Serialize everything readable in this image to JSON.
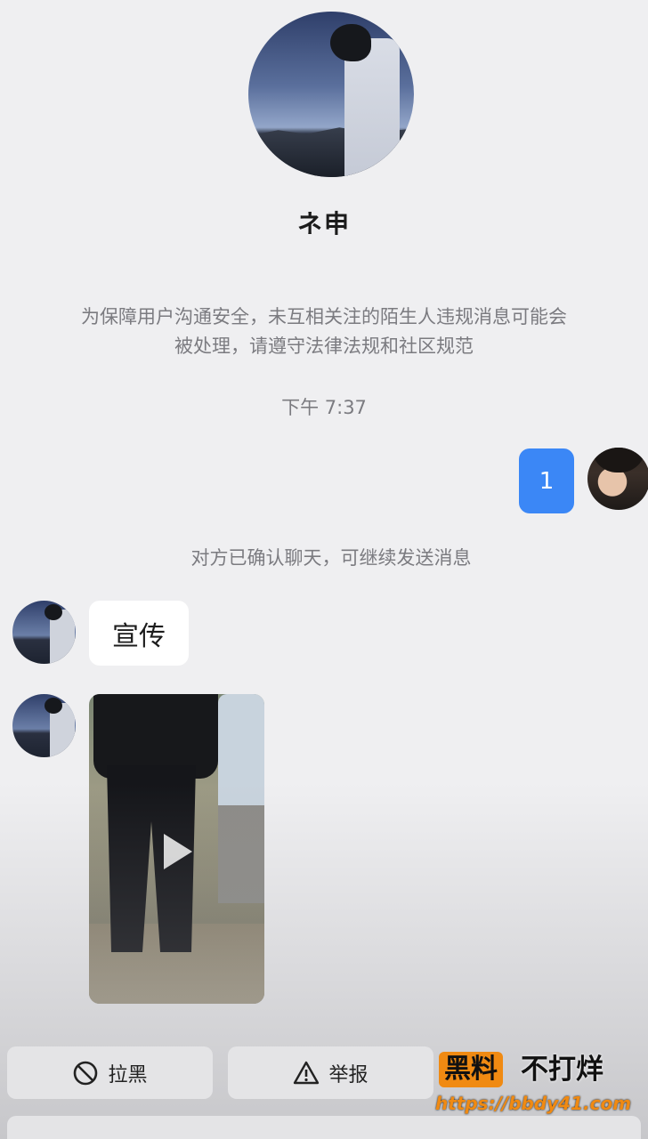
{
  "profile": {
    "name": "ネ申"
  },
  "notice": "为保障用户沟通安全，未互相关注的陌生人违规消息可能会被处理，请遵守法律法规和社区规范",
  "timestamp": "下午 7:37",
  "messages": {
    "outgoing": {
      "text": "1"
    },
    "system": "对方已确认聊天，可继续发送消息",
    "incoming_text": "宣传"
  },
  "actions": {
    "block_label": "拉黑",
    "report_label": "举报"
  },
  "watermark": {
    "badge": "黑料",
    "text": "不打烊",
    "url": "https://bbdy41.com"
  },
  "colors": {
    "background": "#efeff1",
    "outgoing_bubble": "#3b87f6",
    "incoming_bubble": "#ffffff",
    "muted_text": "#7b7b80",
    "watermark_accent": "#f08a12"
  },
  "icons": [
    "play-icon",
    "block-icon",
    "warning-icon"
  ]
}
